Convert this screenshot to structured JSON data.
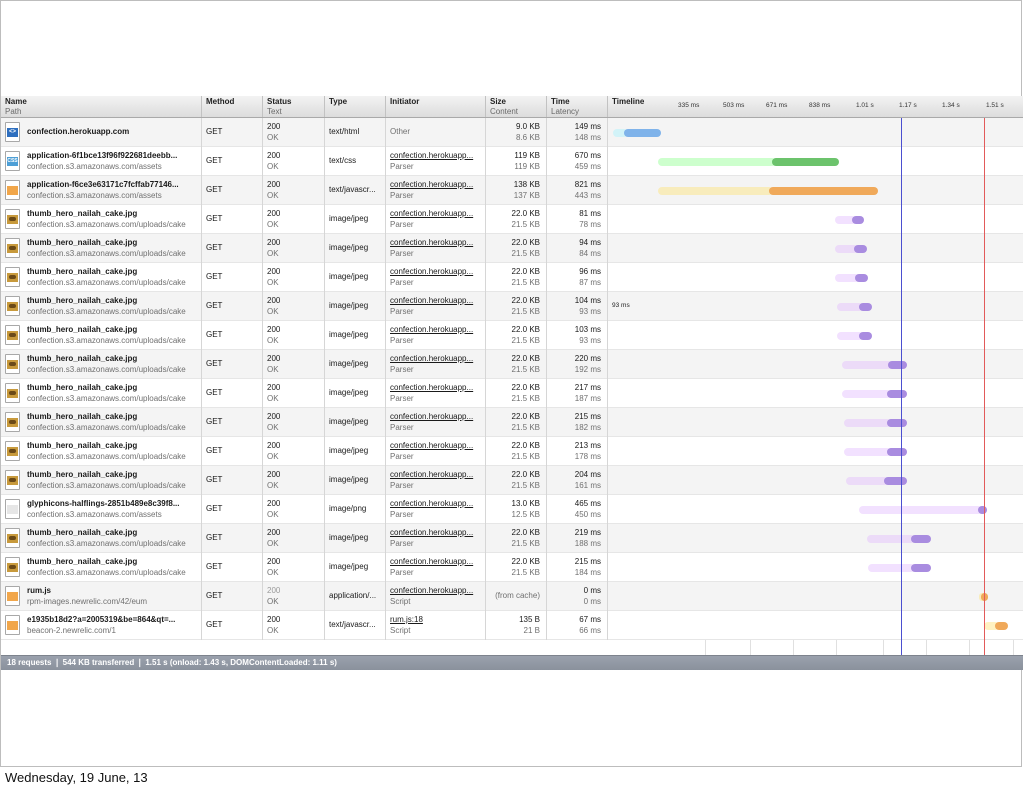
{
  "footer": {
    "date": "Wednesday, 19 June, 13"
  },
  "colors": {
    "html": "#7fb3ea",
    "css": "#6cc36c",
    "js": "#f0a95a",
    "image": "#a98ce0",
    "onload": "#e05a5a",
    "domcontentloaded": "#5b5ed0"
  },
  "columns": {
    "name": {
      "t1": "Name",
      "t2": "Path"
    },
    "method": {
      "t1": "Method",
      "t2": ""
    },
    "status": {
      "t1": "Status",
      "t2": "Text"
    },
    "type": {
      "t1": "Type",
      "t2": ""
    },
    "initiator": {
      "t1": "Initiator",
      "t2": ""
    },
    "size": {
      "t1": "Size",
      "t2": "Content"
    },
    "time": {
      "t1": "Time",
      "t2": "Latency"
    },
    "timeline": {
      "t1": "Timeline",
      "t2": ""
    }
  },
  "ticks": [
    "335 ms",
    "503 ms",
    "671 ms",
    "838 ms",
    "1.01 s",
    "1.17 s",
    "1.34 s",
    "1.51 s"
  ],
  "tooltip_93ms": "93 ms",
  "rows": [
    {
      "icon": "html",
      "icon_glyph": "<>",
      "name": "confection.herokuapp.com",
      "path": "",
      "method": "GET",
      "status": "200",
      "text": "OK",
      "type": "text/html",
      "initiator": "Other",
      "initiator_sub": "",
      "initiator_link": false,
      "size": "9.0 KB",
      "content": "8.6 KB",
      "time": "149 ms",
      "latency": "148 ms",
      "color": "html",
      "start": 612,
      "latEnd": 627,
      "end": 660
    },
    {
      "icon": "css",
      "icon_glyph": "CSS",
      "name": "application-6f1bce13f96f922681deebb...",
      "path": "confection.s3.amazonaws.com/assets",
      "method": "GET",
      "status": "200",
      "text": "OK",
      "type": "text/css",
      "initiator": "confection.herokuapp...",
      "initiator_sub": "Parser",
      "initiator_link": true,
      "size": "119 KB",
      "content": "119 KB",
      "time": "670 ms",
      "latency": "459 ms",
      "color": "css",
      "start": 657,
      "latEnd": 775,
      "end": 838
    },
    {
      "icon": "js",
      "icon_glyph": "",
      "name": "application-f6ce3e63171c7fcffab77146...",
      "path": "confection.s3.amazonaws.com/assets",
      "method": "GET",
      "status": "200",
      "text": "OK",
      "type": "text/javascr...",
      "initiator": "confection.herokuapp...",
      "initiator_sub": "Parser",
      "initiator_link": true,
      "size": "138 KB",
      "content": "137 KB",
      "time": "821 ms",
      "latency": "443 ms",
      "color": "js",
      "start": 657,
      "latEnd": 772,
      "end": 877
    },
    {
      "icon": "img",
      "icon_glyph": "",
      "name": "thumb_hero_nailah_cake.jpg",
      "path": "confection.s3.amazonaws.com/uploads/cake",
      "method": "GET",
      "status": "200",
      "text": "OK",
      "type": "image/jpeg",
      "initiator": "confection.herokuapp...",
      "initiator_sub": "Parser",
      "initiator_link": true,
      "size": "22.0 KB",
      "content": "21.5 KB",
      "time": "81 ms",
      "latency": "78 ms",
      "color": "image",
      "start": 834,
      "latEnd": 855,
      "end": 863
    },
    {
      "icon": "img",
      "icon_glyph": "",
      "name": "thumb_hero_nailah_cake.jpg",
      "path": "confection.s3.amazonaws.com/uploads/cake",
      "method": "GET",
      "status": "200",
      "text": "OK",
      "type": "image/jpeg",
      "initiator": "confection.herokuapp...",
      "initiator_sub": "Parser",
      "initiator_link": true,
      "size": "22.0 KB",
      "content": "21.5 KB",
      "time": "94 ms",
      "latency": "84 ms",
      "color": "image",
      "start": 834,
      "latEnd": 857,
      "end": 866
    },
    {
      "icon": "img",
      "icon_glyph": "",
      "name": "thumb_hero_nailah_cake.jpg",
      "path": "confection.s3.amazonaws.com/uploads/cake",
      "method": "GET",
      "status": "200",
      "text": "OK",
      "type": "image/jpeg",
      "initiator": "confection.herokuapp...",
      "initiator_sub": "Parser",
      "initiator_link": true,
      "size": "22.0 KB",
      "content": "21.5 KB",
      "time": "96 ms",
      "latency": "87 ms",
      "color": "image",
      "start": 834,
      "latEnd": 858,
      "end": 867
    },
    {
      "icon": "img",
      "icon_glyph": "",
      "name": "thumb_hero_nailah_cake.jpg",
      "path": "confection.s3.amazonaws.com/uploads/cake",
      "method": "GET",
      "status": "200",
      "text": "OK",
      "type": "image/jpeg",
      "initiator": "confection.herokuapp...",
      "initiator_sub": "Parser",
      "initiator_link": true,
      "size": "22.0 KB",
      "content": "21.5 KB",
      "time": "104 ms",
      "latency": "93 ms",
      "color": "image",
      "start": 836,
      "latEnd": 862,
      "end": 871
    },
    {
      "icon": "img",
      "icon_glyph": "",
      "name": "thumb_hero_nailah_cake.jpg",
      "path": "confection.s3.amazonaws.com/uploads/cake",
      "method": "GET",
      "status": "200",
      "text": "OK",
      "type": "image/jpeg",
      "initiator": "confection.herokuapp...",
      "initiator_sub": "Parser",
      "initiator_link": true,
      "size": "22.0 KB",
      "content": "21.5 KB",
      "time": "103 ms",
      "latency": "93 ms",
      "color": "image",
      "start": 836,
      "latEnd": 862,
      "end": 871
    },
    {
      "icon": "img",
      "icon_glyph": "",
      "name": "thumb_hero_nailah_cake.jpg",
      "path": "confection.s3.amazonaws.com/uploads/cake",
      "method": "GET",
      "status": "200",
      "text": "OK",
      "type": "image/jpeg",
      "initiator": "confection.herokuapp...",
      "initiator_sub": "Parser",
      "initiator_link": true,
      "size": "22.0 KB",
      "content": "21.5 KB",
      "time": "220 ms",
      "latency": "192 ms",
      "color": "image",
      "start": 841,
      "latEnd": 891,
      "end": 906
    },
    {
      "icon": "img",
      "icon_glyph": "",
      "name": "thumb_hero_nailah_cake.jpg",
      "path": "confection.s3.amazonaws.com/uploads/cake",
      "method": "GET",
      "status": "200",
      "text": "OK",
      "type": "image/jpeg",
      "initiator": "confection.herokuapp...",
      "initiator_sub": "Parser",
      "initiator_link": true,
      "size": "22.0 KB",
      "content": "21.5 KB",
      "time": "217 ms",
      "latency": "187 ms",
      "color": "image",
      "start": 841,
      "latEnd": 890,
      "end": 906
    },
    {
      "icon": "img",
      "icon_glyph": "",
      "name": "thumb_hero_nailah_cake.jpg",
      "path": "confection.s3.amazonaws.com/uploads/cake",
      "method": "GET",
      "status": "200",
      "text": "OK",
      "type": "image/jpeg",
      "initiator": "confection.herokuapp...",
      "initiator_sub": "Parser",
      "initiator_link": true,
      "size": "22.0 KB",
      "content": "21.5 KB",
      "time": "215 ms",
      "latency": "182 ms",
      "color": "image",
      "start": 843,
      "latEnd": 890,
      "end": 906
    },
    {
      "icon": "img",
      "icon_glyph": "",
      "name": "thumb_hero_nailah_cake.jpg",
      "path": "confection.s3.amazonaws.com/uploads/cake",
      "method": "GET",
      "status": "200",
      "text": "OK",
      "type": "image/jpeg",
      "initiator": "confection.herokuapp...",
      "initiator_sub": "Parser",
      "initiator_link": true,
      "size": "22.0 KB",
      "content": "21.5 KB",
      "time": "213 ms",
      "latency": "178 ms",
      "color": "image",
      "start": 843,
      "latEnd": 890,
      "end": 906
    },
    {
      "icon": "img",
      "icon_glyph": "",
      "name": "thumb_hero_nailah_cake.jpg",
      "path": "confection.s3.amazonaws.com/uploads/cake",
      "method": "GET",
      "status": "200",
      "text": "OK",
      "type": "image/jpeg",
      "initiator": "confection.herokuapp...",
      "initiator_sub": "Parser",
      "initiator_link": true,
      "size": "22.0 KB",
      "content": "21.5 KB",
      "time": "204 ms",
      "latency": "161 ms",
      "color": "image",
      "start": 845,
      "latEnd": 887,
      "end": 906
    },
    {
      "icon": "png",
      "icon_glyph": "",
      "name": "glyphicons-halflings-2851b489e8c39f8...",
      "path": "confection.s3.amazonaws.com/assets",
      "method": "GET",
      "status": "200",
      "text": "OK",
      "type": "image/png",
      "initiator": "confection.herokuapp...",
      "initiator_sub": "Parser",
      "initiator_link": true,
      "size": "13.0 KB",
      "content": "12.5 KB",
      "time": "465 ms",
      "latency": "450 ms",
      "color": "image",
      "start": 858,
      "latEnd": 981,
      "end": 986
    },
    {
      "icon": "img",
      "icon_glyph": "",
      "name": "thumb_hero_nailah_cake.jpg",
      "path": "confection.s3.amazonaws.com/uploads/cake",
      "method": "GET",
      "status": "200",
      "text": "OK",
      "type": "image/jpeg",
      "initiator": "confection.herokuapp...",
      "initiator_sub": "Parser",
      "initiator_link": true,
      "size": "22.0 KB",
      "content": "21.5 KB",
      "time": "219 ms",
      "latency": "188 ms",
      "color": "image",
      "start": 866,
      "latEnd": 914,
      "end": 930
    },
    {
      "icon": "img",
      "icon_glyph": "",
      "name": "thumb_hero_nailah_cake.jpg",
      "path": "confection.s3.amazonaws.com/uploads/cake",
      "method": "GET",
      "status": "200",
      "text": "OK",
      "type": "image/jpeg",
      "initiator": "confection.herokuapp...",
      "initiator_sub": "Parser",
      "initiator_link": true,
      "size": "22.0 KB",
      "content": "21.5 KB",
      "time": "215 ms",
      "latency": "184 ms",
      "color": "image",
      "start": 867,
      "latEnd": 914,
      "end": 930
    },
    {
      "icon": "js",
      "icon_glyph": "",
      "name": "rum.js",
      "path": "rpm-images.newrelic.com/42/eum",
      "method": "GET",
      "status": "200",
      "text": "OK",
      "type": "application/...",
      "initiator": "confection.herokuapp...",
      "initiator_sub": "Script",
      "initiator_link": true,
      "size": "(from cache)",
      "content": "",
      "time": "0 ms",
      "latency": "0 ms",
      "color": "js",
      "start": 978,
      "latEnd": 984,
      "end": 987,
      "muted": true
    },
    {
      "icon": "js",
      "icon_glyph": "",
      "name": "e1935b18d2?a=2005319&be=864&qt=...",
      "path": "beacon-2.newrelic.com/1",
      "method": "GET",
      "status": "200",
      "text": "OK",
      "type": "text/javascr...",
      "initiator": "rum.js:18",
      "initiator_sub": "Script",
      "initiator_link": true,
      "size": "135 B",
      "content": "21 B",
      "time": "67 ms",
      "latency": "66 ms",
      "color": "js",
      "start": 983,
      "latEnd": 998,
      "end": 1007
    }
  ],
  "status_bar": "18 requests  ❘  544 KB transferred  ❘  1.51 s (onload: 1.43 s, DOMContentLoaded: 1.11 s)"
}
